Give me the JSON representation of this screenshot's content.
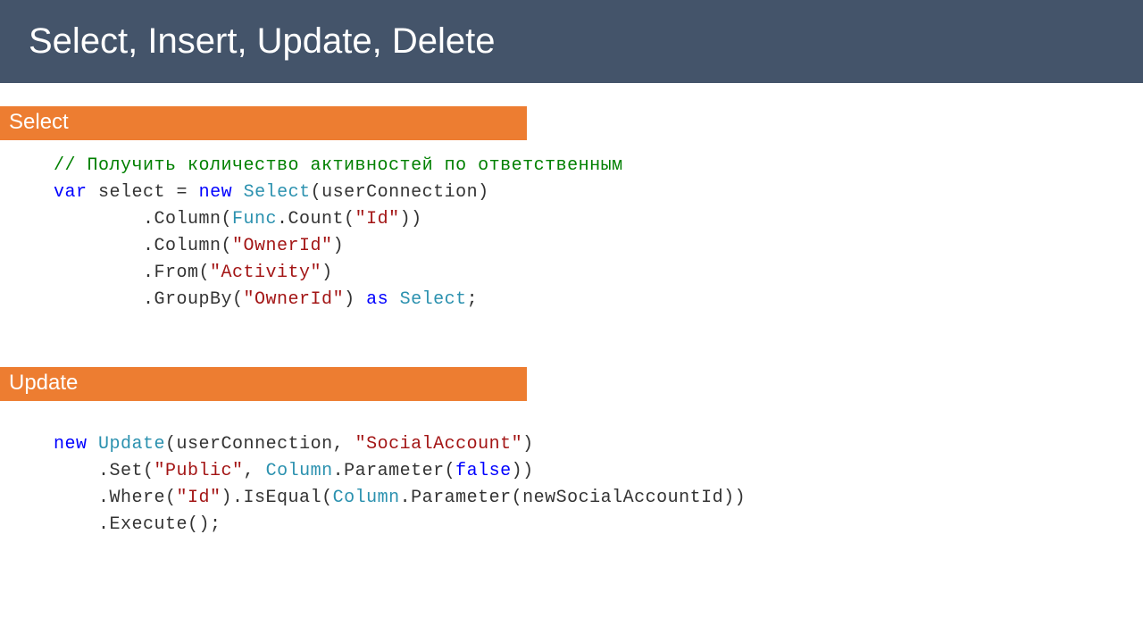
{
  "header": {
    "title": "Select, Insert, Update, Delete"
  },
  "sections": {
    "select": {
      "label": "Select"
    },
    "update": {
      "label": "Update"
    }
  },
  "code": {
    "select": {
      "comment": "// Получить количество активностей по ответственным",
      "kw_var": "var",
      "ident_select": "select",
      "eq": " = ",
      "kw_new": "new",
      "type_select": "Select",
      "arg_userconn": "(userConnection)",
      "l2a": "        .Column(",
      "type_func": "Func",
      "l2b": ".Count(",
      "str_id": "\"Id\"",
      "l2c": "))",
      "l3a": "        .Column(",
      "str_ownerid": "\"OwnerId\"",
      "l3b": ")",
      "l4a": "        .From(",
      "str_activity": "\"Activity\"",
      "l4b": ")",
      "l5a": "        .GroupBy(",
      "str_ownerid2": "\"OwnerId\"",
      "l5b": ") ",
      "kw_as": "as",
      "sp": " ",
      "type_select2": "Select",
      "semi": ";"
    },
    "update": {
      "kw_new": "new",
      "sp": " ",
      "type_update": "Update",
      "l1a": "(userConnection, ",
      "str_social": "\"SocialAccount\"",
      "l1b": ")",
      "l2a": "    .Set(",
      "str_public": "\"Public\"",
      "l2b": ", ",
      "type_column": "Column",
      "l2c": ".Parameter(",
      "kw_false": "false",
      "l2d": "))",
      "l3a": "    .Where(",
      "str_id": "\"Id\"",
      "l3b": ").IsEqual(",
      "type_column2": "Column",
      "l3c": ".Parameter(newSocialAccountId))",
      "l4": "    .Execute();"
    }
  }
}
